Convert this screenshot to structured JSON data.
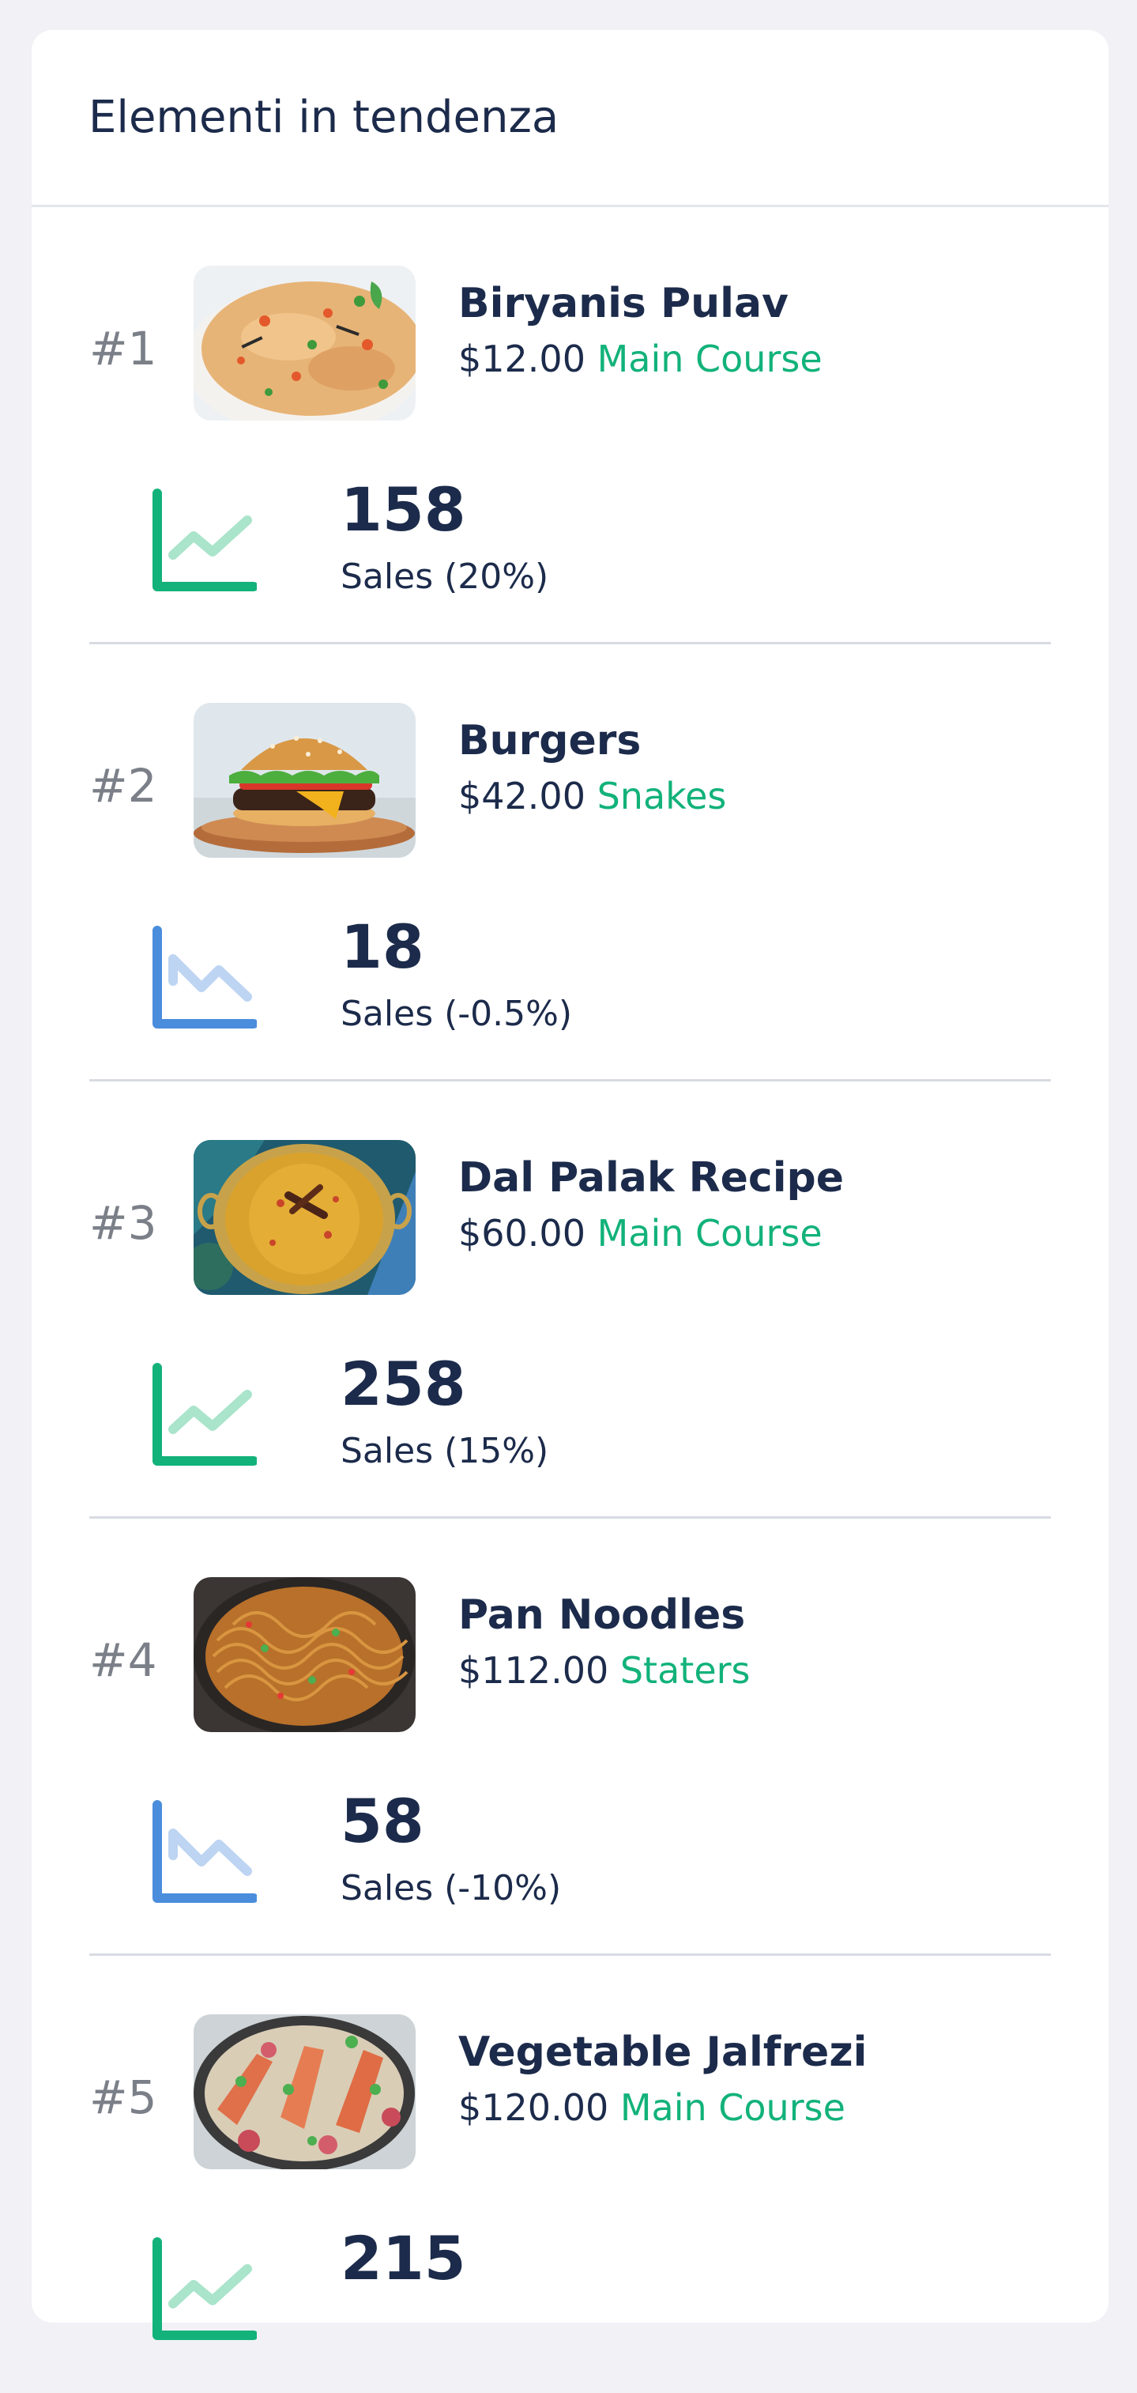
{
  "card": {
    "title": "Elementi in tendenza"
  },
  "colors": {
    "up": "#12b27a",
    "down": "#4a8ddc",
    "text": "#1c2b4b",
    "rank": "#7b7f88"
  },
  "items": [
    {
      "rank": "#1",
      "name": "Biryanis Pulav",
      "price": "$12.00",
      "category": "Main Course",
      "sales": "158",
      "sales_label": "Sales (20%)",
      "trend": "up",
      "image": "biryani-image"
    },
    {
      "rank": "#2",
      "name": "Burgers",
      "price": "$42.00",
      "category": "Snakes",
      "sales": "18",
      "sales_label": "Sales (-0.5%)",
      "trend": "down",
      "image": "burger-image"
    },
    {
      "rank": "#3",
      "name": "Dal Palak Recipe",
      "price": "$60.00",
      "category": "Main Course",
      "sales": "258",
      "sales_label": "Sales (15%)",
      "trend": "up",
      "image": "dal-palak-image"
    },
    {
      "rank": "#4",
      "name": "Pan Noodles",
      "price": "$112.00",
      "category": "Staters",
      "sales": "58",
      "sales_label": "Sales (-10%)",
      "trend": "down",
      "image": "noodles-image"
    },
    {
      "rank": "#5",
      "name": "Vegetable Jalfrezi",
      "price": "$120.00",
      "category": "Main Course",
      "sales": "215",
      "sales_label": "",
      "trend": "up",
      "image": "jalfrezi-image"
    }
  ]
}
